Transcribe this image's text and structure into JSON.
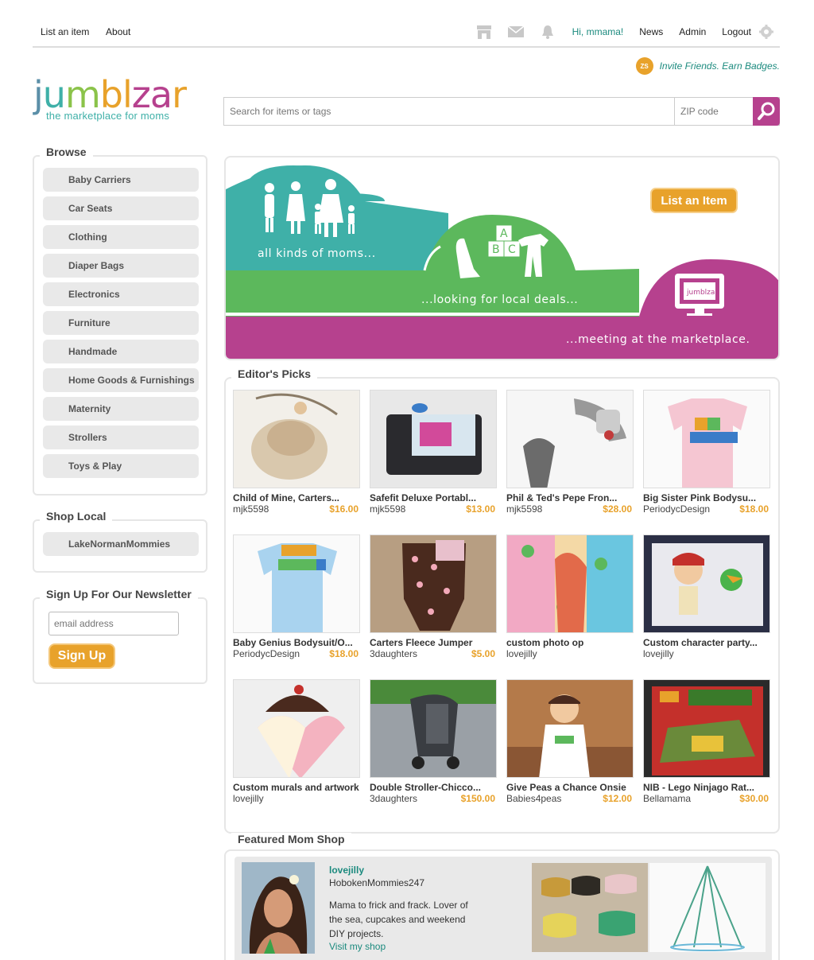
{
  "topnav": {
    "list_item": "List an item",
    "about": "About",
    "greeting": "Hi, mmama!",
    "news": "News",
    "admin": "Admin",
    "logout": "Logout",
    "icons": [
      "store-icon",
      "mail-icon",
      "bell-icon",
      "gear-icon"
    ]
  },
  "invite": {
    "badge": "ZS",
    "text": "Invite Friends. Earn Badges."
  },
  "logo": {
    "letters": [
      "j",
      "u",
      "m",
      "b",
      "l",
      "z",
      "a",
      "r"
    ],
    "letter_colors": [
      "#5b8fa8",
      "#3fb0a8",
      "#8bc34a",
      "#e8a22b",
      "#e8a22b",
      "#b6418e",
      "#b6418e",
      "#e8a22b"
    ],
    "tagline": "the marketplace for moms"
  },
  "search": {
    "placeholder": "Search for items or tags",
    "zip_placeholder": "ZIP code"
  },
  "browse": {
    "title": "Browse",
    "categories": [
      "Baby Carriers",
      "Car Seats",
      "Clothing",
      "Diaper Bags",
      "Electronics",
      "Furniture",
      "Handmade",
      "Home Goods & Furnishings",
      "Maternity",
      "Strollers",
      "Toys & Play"
    ]
  },
  "shop_local": {
    "title": "Shop Local",
    "items": [
      "LakeNormanMommies"
    ]
  },
  "newsletter": {
    "title": "Sign Up For Our Newsletter",
    "placeholder": "email address",
    "button": "Sign Up"
  },
  "hero": {
    "line1": "all kinds of moms...",
    "line2": "...looking for local deals...",
    "line3": "...meeting at the marketplace.",
    "button": "List an Item",
    "screen_text": "jumblzar",
    "colors": {
      "teal": "#3fb0a8",
      "green": "#5cb85c",
      "magenta": "#b6418e",
      "orange": "#e8a22b"
    }
  },
  "editors_picks": {
    "title": "Editor's Picks",
    "items": [
      {
        "name": "Child of Mine, Carters...",
        "seller": "mjk5598",
        "price": "$16.00"
      },
      {
        "name": "Safefit Deluxe Portabl...",
        "seller": "mjk5598",
        "price": "$13.00"
      },
      {
        "name": "Phil & Ted's Pepe Fron...",
        "seller": "mjk5598",
        "price": "$28.00"
      },
      {
        "name": "Big Sister Pink Bodysu...",
        "seller": "PeriodycDesign",
        "price": "$18.00"
      },
      {
        "name": "Baby Genius Bodysuit/O...",
        "seller": "PeriodycDesign",
        "price": "$18.00"
      },
      {
        "name": "Carters Fleece Jumper",
        "seller": "3daughters",
        "price": "$5.00"
      },
      {
        "name": "custom photo op",
        "seller": "lovejilly",
        "price": ""
      },
      {
        "name": "Custom character party...",
        "seller": "lovejilly",
        "price": ""
      },
      {
        "name": "Custom murals and artwork",
        "seller": "lovejilly",
        "price": ""
      },
      {
        "name": "Double Stroller-Chicco...",
        "seller": "3daughters",
        "price": "$150.00"
      },
      {
        "name": "Give Peas a Chance Onsie",
        "seller": "Babies4peas",
        "price": "$12.00"
      },
      {
        "name": "NIB - Lego Ninjago Rat...",
        "seller": "Bellamama",
        "price": "$30.00"
      }
    ]
  },
  "featured": {
    "title": "Featured Mom Shop",
    "name": "lovejilly",
    "group": "HobokenMommies247",
    "bio": "Mama to frick and frack. Lover of the sea, cupcakes and weekend DIY projects.",
    "link": "Visit my shop"
  }
}
